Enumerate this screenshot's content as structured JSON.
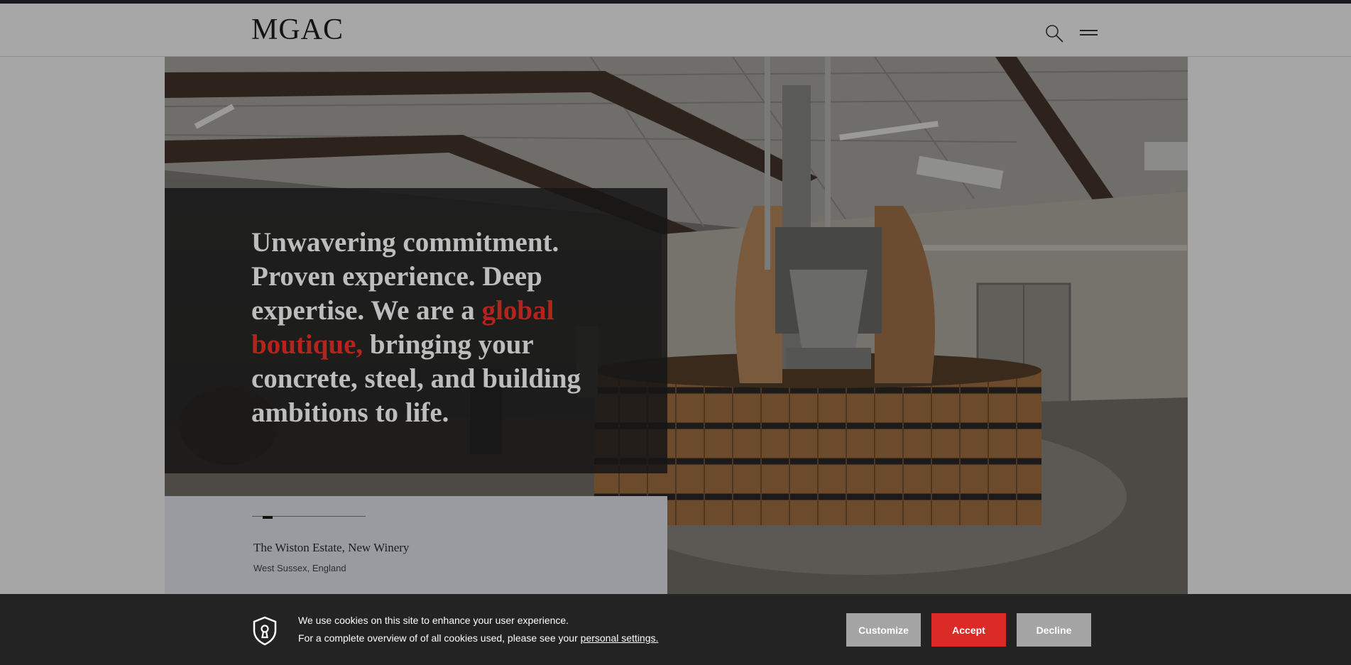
{
  "header": {
    "logo": "MGAC",
    "search_icon": "search-icon",
    "menu_icon": "hamburger-menu-icon"
  },
  "hero": {
    "headline_part1": "Unwavering commitment. Proven experience. Deep expertise. We are a ",
    "headline_accent": "global boutique,",
    "headline_part2": " bringing your concrete, steel, and building ambitions to life.",
    "accent_color": "#b5231f",
    "slide_indicator": {
      "current": 1
    },
    "project": {
      "name": "The Wiston Estate, New Winery",
      "location": "West Sussex, England"
    }
  },
  "cookie_banner": {
    "icon": "shield-lock-icon",
    "line1": "We use cookies on this site to enhance your user experience.",
    "line2_text": "For a complete overview of of all cookies used, please see your ",
    "line2_link": "personal settings.",
    "buttons": {
      "customize": "Customize",
      "accept": "Accept",
      "decline": "Decline"
    },
    "accept_color": "#db2b26"
  }
}
